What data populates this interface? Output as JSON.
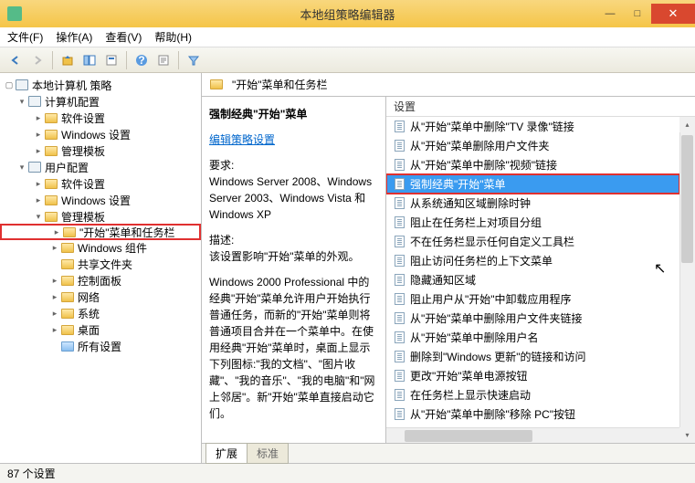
{
  "window": {
    "title": "本地组策略编辑器"
  },
  "menu": {
    "file": "文件(F)",
    "action": "操作(A)",
    "view": "查看(V)",
    "help": "帮助(H)"
  },
  "tree": {
    "root": "本地计算机 策略",
    "computer": "计算机配置",
    "c_soft": "软件设置",
    "c_win": "Windows 设置",
    "c_admin": "管理模板",
    "user": "用户配置",
    "u_soft": "软件设置",
    "u_win": "Windows 设置",
    "u_admin": "管理模板",
    "start_menu": "\"开始\"菜单和任务栏",
    "win_comp": "Windows 组件",
    "shared": "共享文件夹",
    "cp": "控制面板",
    "net": "网络",
    "sys": "系统",
    "desk": "桌面",
    "all": "所有设置"
  },
  "content": {
    "header": "\"开始\"菜单和任务栏",
    "policy_name": "强制经典\"开始\"菜单",
    "edit_link": "编辑策略设置",
    "req_label": "要求:",
    "req_text": "Windows Server 2008、Windows Server 2003、Windows Vista 和 Windows XP",
    "desc_label": "描述:",
    "desc_text": "该设置影响\"开始\"菜单的外观。",
    "desc_para2": "Windows 2000 Professional 中的经典\"开始\"菜单允许用户开始执行普通任务，而新的\"开始\"菜单则将普通项目合并在一个菜单中。在使用经典\"开始\"菜单时，桌面上显示下列图标:\"我的文档\"、\"图片收藏\"、\"我的音乐\"、\"我的电脑\"和\"网上邻居\"。新\"开始\"菜单直接启动它们。"
  },
  "listhead": {
    "col": "设置"
  },
  "items": [
    "从\"开始\"菜单中删除\"TV 录像\"链接",
    "从\"开始\"菜单删除用户文件夹",
    "从\"开始\"菜单中删除\"视频\"链接",
    "强制经典\"开始\"菜单",
    "从系统通知区域删除时钟",
    "阻止在任务栏上对项目分组",
    "不在任务栏显示任何自定义工具栏",
    "阻止访问任务栏的上下文菜单",
    "隐藏通知区域",
    "阻止用户从\"开始\"中卸载应用程序",
    "从\"开始\"菜单中删除用户文件夹链接",
    "从\"开始\"菜单中删除用户名",
    "删除到\"Windows 更新\"的链接和访问",
    "更改\"开始\"菜单电源按钮",
    "在任务栏上显示快速启动",
    "从\"开始\"菜单中删除\"移除 PC\"按钮"
  ],
  "tabs": {
    "ext": "扩展",
    "std": "标准"
  },
  "status": {
    "count": "87 个设置"
  }
}
